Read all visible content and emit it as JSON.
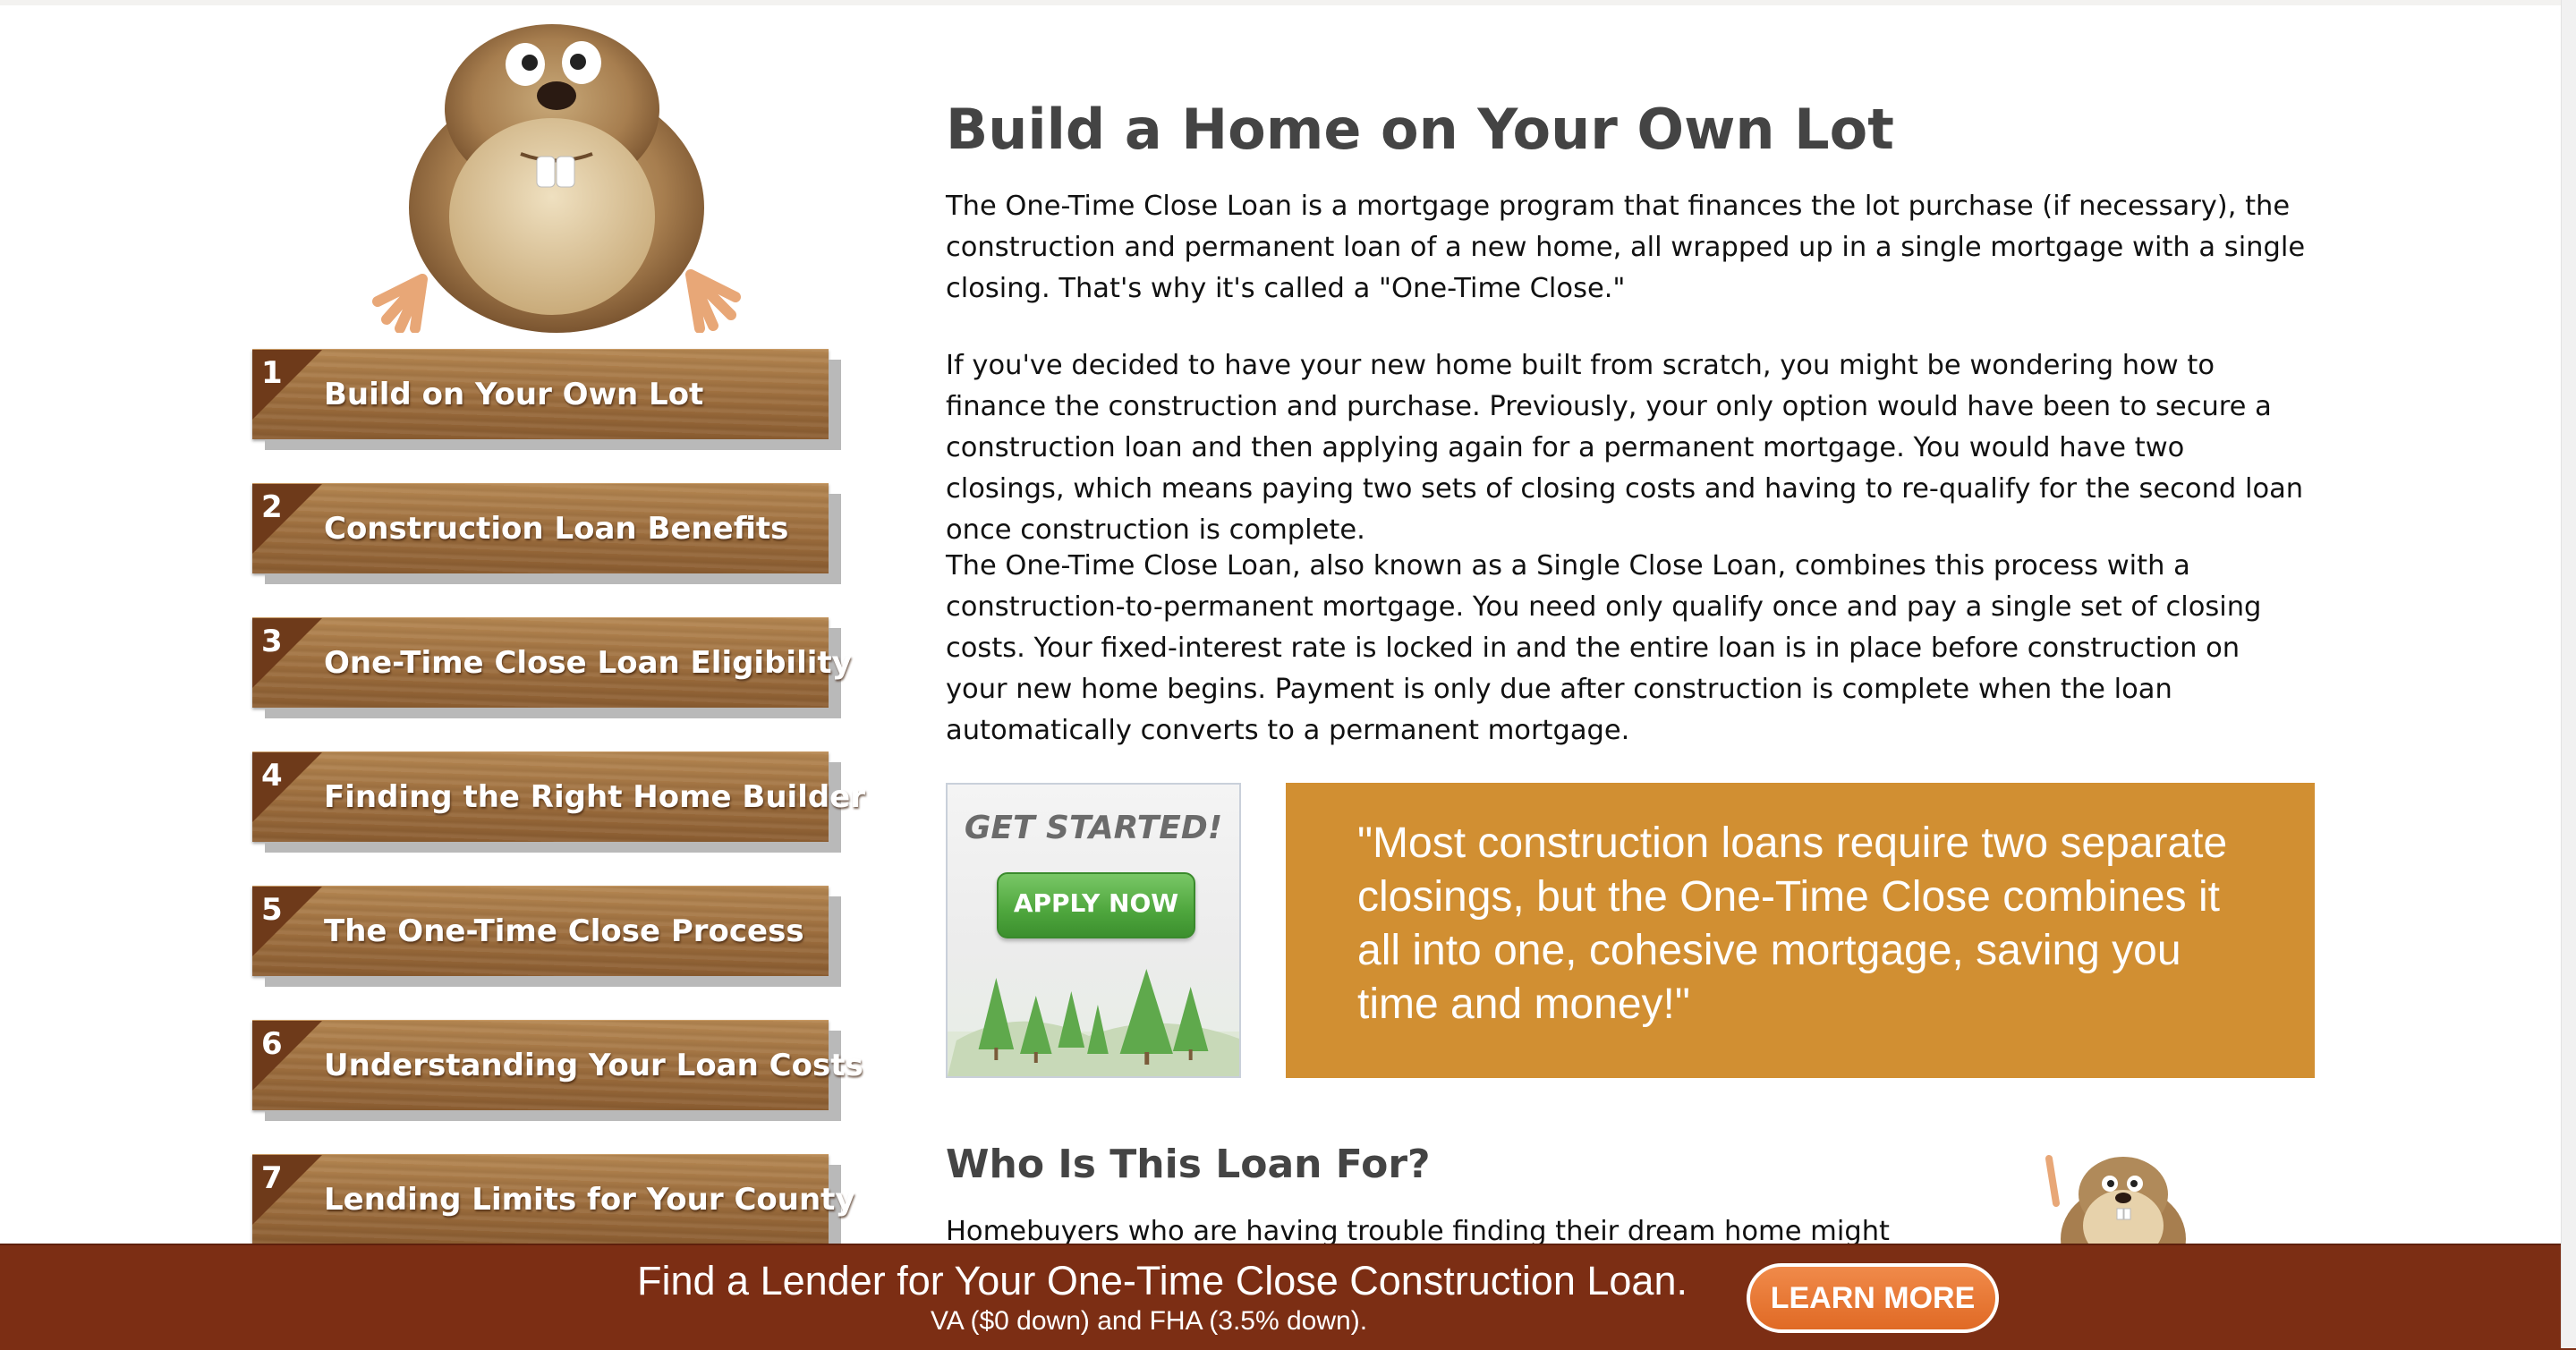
{
  "sidebar": {
    "items": [
      {
        "num": "1",
        "label": "Build on Your Own Lot"
      },
      {
        "num": "2",
        "label": "Construction Loan Benefits"
      },
      {
        "num": "3",
        "label": "One-Time Close Loan Eligibility"
      },
      {
        "num": "4",
        "label": "Finding the Right Home Builder"
      },
      {
        "num": "5",
        "label": "The One-Time Close Process"
      },
      {
        "num": "6",
        "label": "Understanding Your Loan Costs"
      },
      {
        "num": "7",
        "label": "Lending Limits for Your County"
      }
    ]
  },
  "main": {
    "title": "Build a Home on Your Own Lot",
    "paragraphs": [
      "The One-Time Close Loan is a mortgage program that finances the lot purchase (if necessary), the construction and permanent loan of a new home, all wrapped up in a single mortgage with a single closing. That's why it's called a \"One-Time Close.\"",
      "If you've decided to have your new home built from scratch, you might be wondering how to finance the construction and purchase. Previously, your only option would have been to secure a construction loan and then applying again for a permanent mortgage. You would have two closings, which means paying two sets of closing costs and having to re-qualify for the second loan once construction is complete.",
      "The One-Time Close Loan, also known as a Single Close Loan, combines this process with a construction-to-permanent mortgage. You need only qualify once and pay a single set of closing costs. Your fixed-interest rate is locked in and the entire loan is in place before construction on your new home begins. Payment is only due after construction is complete when the loan automatically converts to a permanent mortgage."
    ],
    "cta": {
      "title": "GET STARTED!",
      "button": "APPLY NOW"
    },
    "quote": "\"Most construction loans require two separate closings, but the One-Time Close combines it all into one, cohesive mortgage, saving you time and money!\"",
    "subheading": "Who Is This Loan For?",
    "subheading_text": "Homebuyers who are having trouble finding their dream home might decide"
  },
  "banner": {
    "title": "Find a Lender for Your One-Time Close Construction Loan.",
    "subtitle": "VA ($0 down) and FHA (3.5% down).",
    "button": "LEARN MORE"
  },
  "colors": {
    "quote_bg": "#d18f32",
    "banner_bg": "#7c2e14",
    "wood": "#a57545",
    "apply_green": "#4ea63d",
    "learn_orange": "#e06a25"
  },
  "icons": {
    "mascot": "gopher-mascot-icon",
    "trees": "trees-illustration-icon"
  }
}
